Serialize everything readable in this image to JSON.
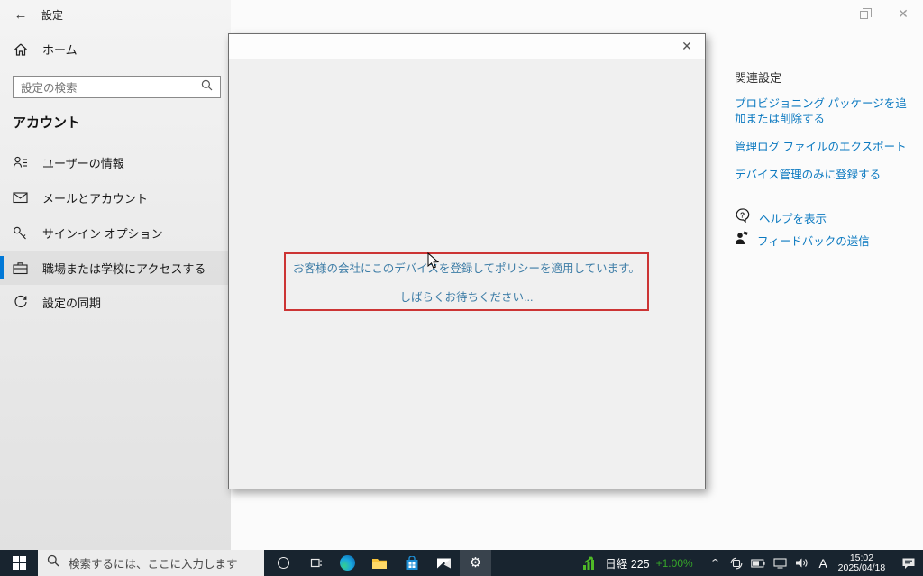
{
  "window": {
    "title": "設定",
    "controls": {
      "close_glyph": "✕"
    }
  },
  "sidebar": {
    "back_glyph": "←",
    "home_label": "ホーム",
    "search_placeholder": "設定の検索",
    "section_header": "アカウント",
    "items": [
      {
        "label": "ユーザーの情報",
        "icon": "user-info-icon"
      },
      {
        "label": "メールとアカウント",
        "icon": "mail-icon"
      },
      {
        "label": "サインイン オプション",
        "icon": "key-icon"
      },
      {
        "label": "職場または学校にアクセスする",
        "icon": "briefcase-icon",
        "selected": true
      },
      {
        "label": "設定の同期",
        "icon": "sync-icon"
      }
    ]
  },
  "related": {
    "header": "関連設定",
    "links": [
      "プロビジョニング パッケージを追加または削除する",
      "管理ログ ファイルのエクスポート",
      "デバイス管理のみに登録する"
    ],
    "help_link": "ヘルプを表示",
    "feedback_link": "フィードバックの送信"
  },
  "dialog": {
    "close_glyph": "✕",
    "message_line1": "お客様の会社にこのデバイスを登録してポリシーを適用しています。",
    "message_line2": "しばらくお待ちください..."
  },
  "taskbar": {
    "search_placeholder": "検索するには、ここに入力します",
    "stock_name": "日経 225",
    "stock_change": "+1.00%",
    "chevron_glyph": "⌃",
    "ime_indicator": "A",
    "time": "15:02",
    "date": "2025/04/18"
  },
  "colors": {
    "accent": "#0078d7",
    "alert_border_red": "#cc3434",
    "message_blue": "#3c7ca6",
    "link_blue": "#0b79c0",
    "stock_green": "#36a829",
    "taskbar_bg": "#18242f"
  }
}
